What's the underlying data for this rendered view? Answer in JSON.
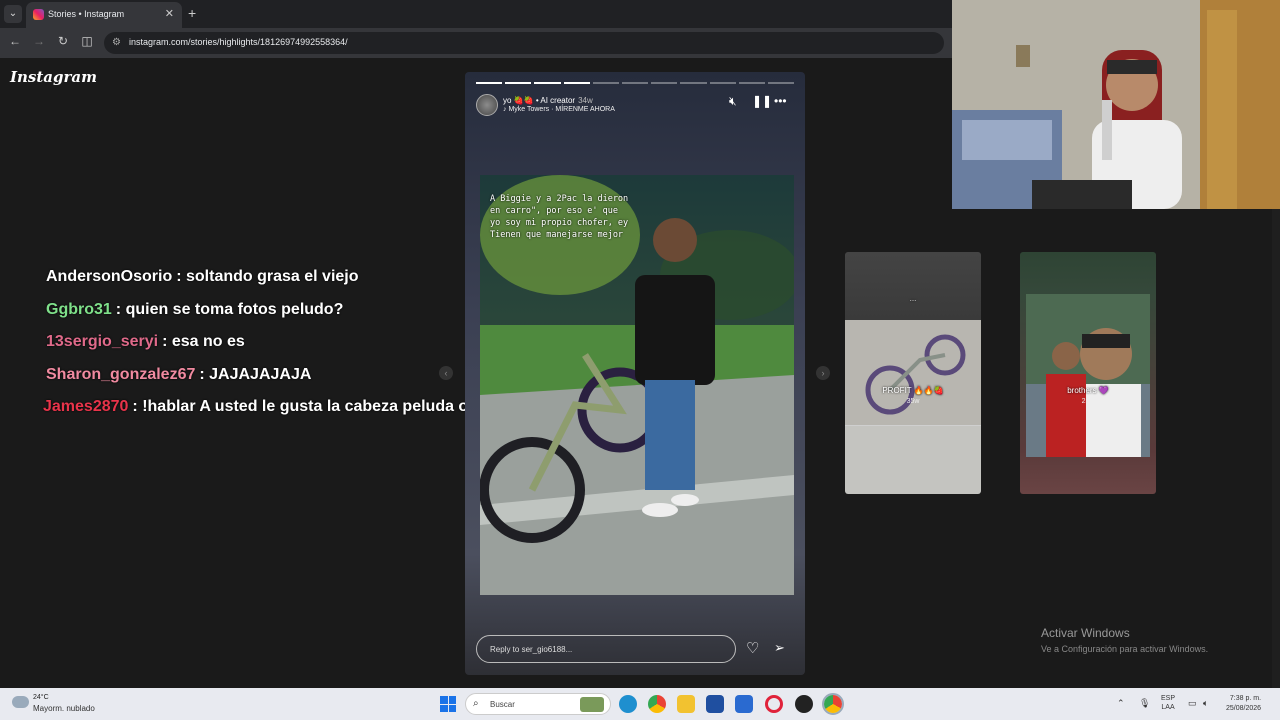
{
  "browser": {
    "tab_title": "Stories • Instagram",
    "url": "instagram.com/stories/highlights/18126974992558364/"
  },
  "page": {
    "logo": "Instagram"
  },
  "chat": [
    {
      "user": "AndersonOsorio",
      "user_color": "#ffffff",
      "message": ": soltando grasa el viejo"
    },
    {
      "user": "Ggbro31",
      "user_color": "#7fe08a",
      "message": ": quien se toma fotos peludo?"
    },
    {
      "user": "13sergio_seryi",
      "user_color": "#e06a8a",
      "message": ": esa no es"
    },
    {
      "user": "Sharon_gonzalez67",
      "user_color": "#f08aa0",
      "message": ": JAJAJAJAJA"
    },
    {
      "user": "James2870",
      "user_color": "#e8344a",
      "message": ": !hablar A usted le gusta la cabeza peluda o pelada?"
    }
  ],
  "story": {
    "username": "yo 🍓🍓 • AI creator",
    "age": "34w",
    "music": "♪ Myke Towers · MÍRENME AHORA",
    "caption": "A Biggie y a 2Pac la dieron en carro\", por eso e' que yo soy mi propio chofer, ey Tienen que manejarse mejor",
    "reply_placeholder": "Reply to ser_gio6188...",
    "progress_total": 11,
    "progress_done": 4
  },
  "previews": [
    {
      "label": "PROFIT 🔥🔥🍓",
      "age": "35w",
      "top_text": "..."
    },
    {
      "label": "brothers 💜",
      "age": "25w"
    }
  ],
  "watermark": {
    "title": "Activar Windows",
    "subtitle": "Ve a Configuración para activar Windows."
  },
  "taskbar": {
    "temperature": "24°C",
    "weather": "Mayorm. nublado",
    "search_placeholder": "Buscar",
    "lang_1": "ESP",
    "lang_2": "LAA",
    "time": "7:38 p. m.",
    "date": "25/08/2026"
  }
}
